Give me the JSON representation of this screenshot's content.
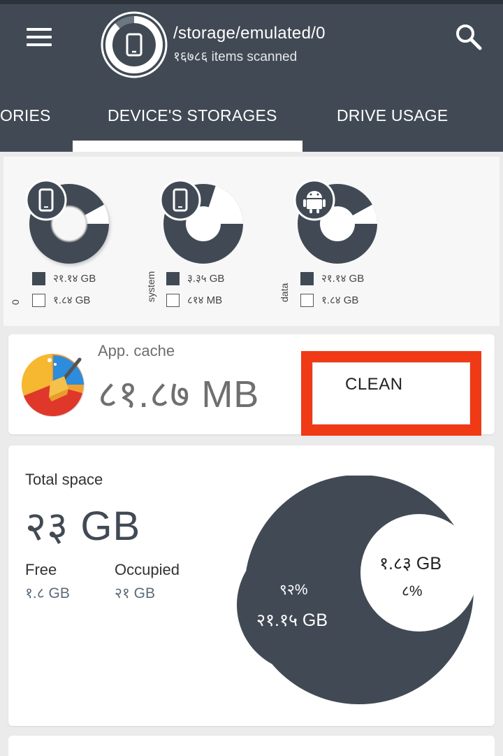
{
  "header": {
    "path": "/storage/emulated/0",
    "items_scanned": "१६७८६ items scanned"
  },
  "tabs": [
    {
      "label": "ORIES"
    },
    {
      "label": "DEVICE'S STORAGES"
    },
    {
      "label": "DRIVE USAGE"
    }
  ],
  "storages": [
    {
      "name": "0",
      "icon": "phone-icon",
      "used": "२१.१४ GB",
      "free": "१.८४ GB",
      "used_fraction": 0.92
    },
    {
      "name": "system",
      "icon": "phone-icon",
      "used": "३.३५ GB",
      "free": "८१४ MB",
      "used_fraction": 0.8
    },
    {
      "name": "data",
      "icon": "android-icon",
      "used": "२१.१४ GB",
      "free": "१.८४ GB",
      "used_fraction": 0.92
    }
  ],
  "cache": {
    "label": "App. cache",
    "size": "८१.८७ MB",
    "button": "CLEAN"
  },
  "total": {
    "label": "Total space",
    "value": "२३ GB",
    "free_label": "Free",
    "free_value": "१.८ GB",
    "occupied_label": "Occupied",
    "occupied_value": "२१ GB",
    "occupied_percent": "९२%",
    "occupied_size": "२१.१५ GB",
    "free_size": "१.८३ GB",
    "free_percent": "८%"
  },
  "colors": {
    "primary": "#414a54",
    "highlight": "#f03a16"
  }
}
